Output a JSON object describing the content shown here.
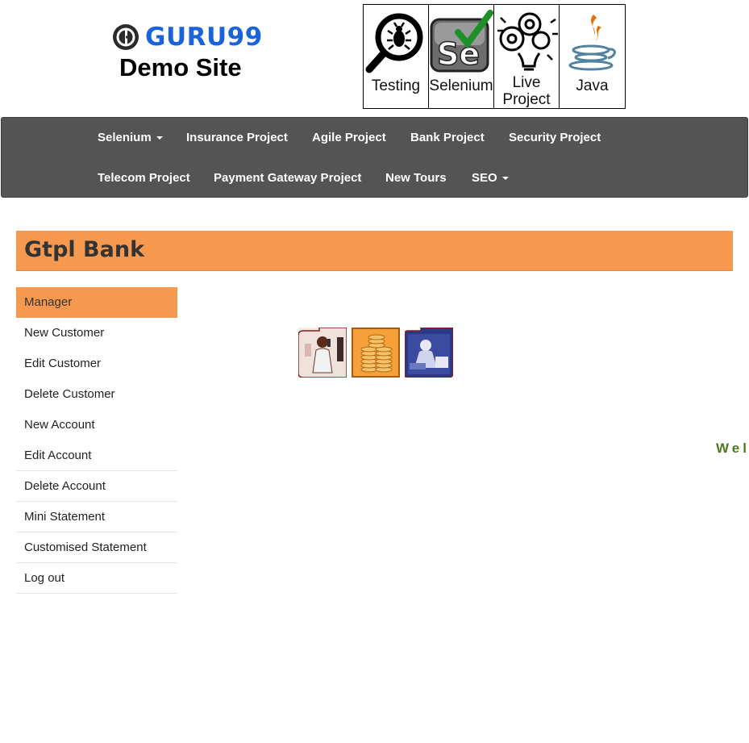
{
  "brand": {
    "logo_text": "GURU99",
    "subtitle": "Demo Site"
  },
  "tiles": [
    {
      "label": "Testing",
      "icon": "bug-magnifier-icon"
    },
    {
      "label": "Selenium",
      "icon": "selenium-icon"
    },
    {
      "label": "Live Project",
      "icon": "lightbulb-gears-icon"
    },
    {
      "label": "Java",
      "icon": "java-icon"
    }
  ],
  "nav": {
    "row1": [
      "Selenium",
      "Insurance Project",
      "Agile Project",
      "Bank Project",
      "Security Project"
    ],
    "row2": [
      "Telecom Project",
      "Payment Gateway Project",
      "New Tours",
      "SEO"
    ]
  },
  "bank": {
    "title": "Gtpl Bank"
  },
  "menu": [
    "Manager",
    "New Customer",
    "Edit Customer",
    "Delete Customer",
    "New Account",
    "Edit Account",
    "Delete Account",
    "Mini Statement",
    "Customised Statement",
    "Log out"
  ],
  "marquee_text": "Wel",
  "colors": {
    "accent": "#f6994f",
    "nav_bg": "#545454",
    "brand_blue": "#1a63d8",
    "marquee_green": "#4d7a1e"
  }
}
